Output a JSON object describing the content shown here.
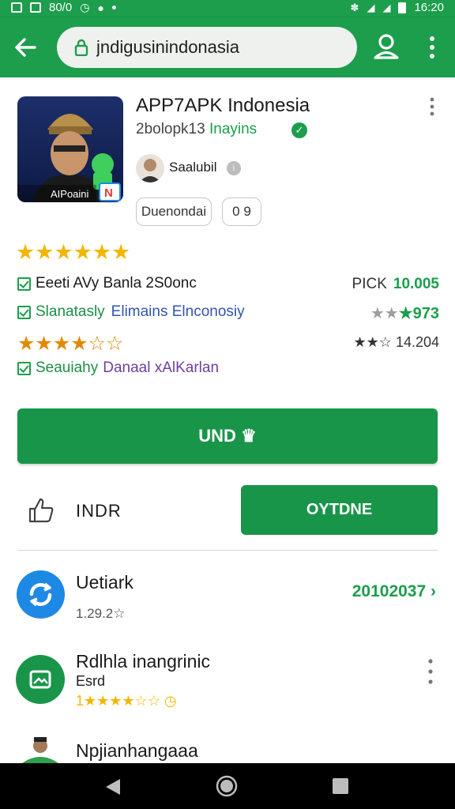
{
  "status_bar": {
    "time": "16:20",
    "left_text": "80/0"
  },
  "browser": {
    "url": "jndigusinindonasia"
  },
  "app": {
    "title": "APP7APK Indonesia",
    "subtitle_a": "2⁠bolopk13",
    "subtitle_b": "Inayins",
    "icon_label": "AIPoaini",
    "icon_badge": "N",
    "developer": "Saalubil",
    "chip1": "Duenondai",
    "chip2": "0 9"
  },
  "features": [
    {
      "text": "Eeeti AVy Banla 2S0onc",
      "value_a": "PICK",
      "value_b": "10.005"
    },
    {
      "text": "Slanatasly",
      "text2": "Elimains Elnconosiy",
      "value_stars": "★★",
      "value_b": "★973"
    },
    {
      "text": "★★★★☆☆",
      "value_b": "★★☆ 14.204"
    },
    {
      "text": "Seauiahy",
      "text2": "Danaal xAlKarlan"
    }
  ],
  "actions": {
    "install_label": "UND ♛",
    "like_label": "INDR",
    "open_label": "OYTDNE"
  },
  "list": [
    {
      "title": "Uetiark",
      "subtitle": "1.29.2☆",
      "value": "20102037 ›"
    },
    {
      "title": "Rdlhla inangrinic",
      "subtitle": "Esrd",
      "stars": "1★★★★☆☆ ◷"
    },
    {
      "title": "Npjianhangaaa"
    }
  ],
  "colors": {
    "accent": "#1c9e4c",
    "install": "#19954a",
    "star": "#f2b600",
    "list_icon_blue": "#1e88e5"
  }
}
